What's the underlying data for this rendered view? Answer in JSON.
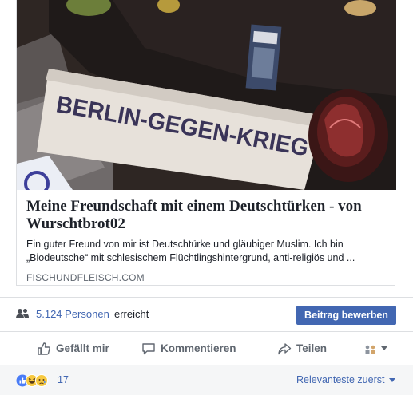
{
  "link_preview": {
    "image_alt_text": "BERLIN-GEGEN-KRIEG",
    "title": "Meine Freundschaft mit einem Deutschtürken - von Wurschtbrot02",
    "description_line1": "Ein guter Freund von mir ist Deutschtürke und gläubiger Muslim. Ich bin",
    "description_line2": "„Biodeutsche“ mit schlesischem Flüchtlingshintergrund, anti-religiös und ...",
    "domain": "FISCHUNDFLEISCH.COM"
  },
  "reach": {
    "icon": "people-icon",
    "count": "5.124 Personen",
    "suffix": "erreicht",
    "boost_label": "Beitrag bewerben"
  },
  "actions": {
    "like_label": "Gefällt mir",
    "comment_label": "Kommentieren",
    "share_label": "Teilen",
    "like_icon": "thumbs-up-icon",
    "comment_icon": "speech-bubble-icon",
    "share_icon": "share-arrow-icon"
  },
  "reactions": {
    "icons": [
      "like-reaction-icon",
      "haha-reaction-icon",
      "sad-reaction-icon"
    ],
    "count": "17",
    "sort_label": "Relevanteste zuerst"
  },
  "colors": {
    "link_blue": "#4267b2",
    "secondary_text": "#606770",
    "border": "#dddfe2"
  }
}
